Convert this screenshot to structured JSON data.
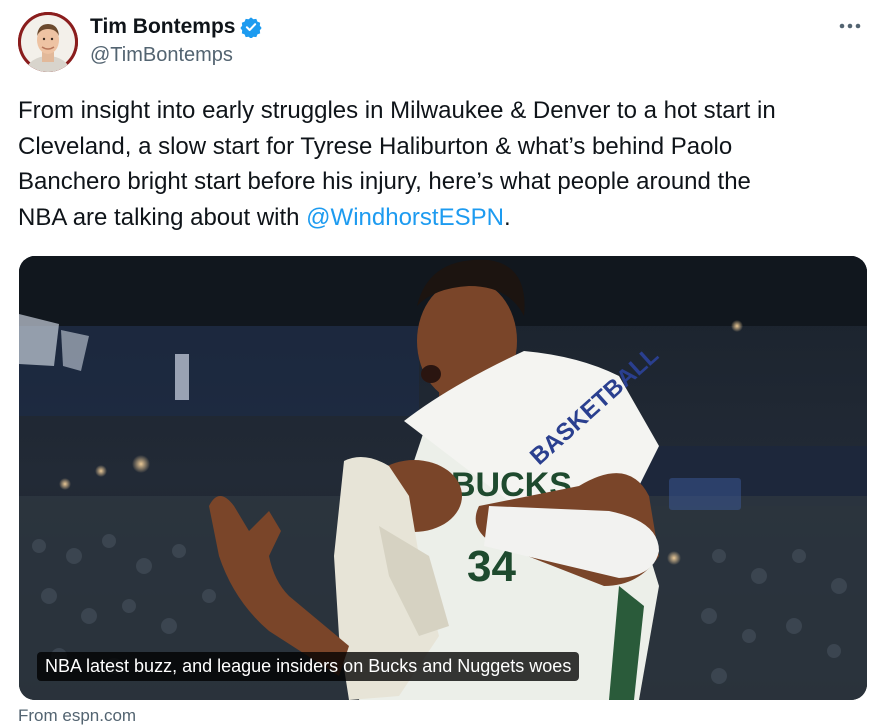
{
  "author": {
    "display_name": "Tim Bontemps",
    "handle": "@TimBontemps",
    "verified": true,
    "avatar_icon": "profile-photo",
    "verified_color": "#1d9bf0"
  },
  "menu_icon": "more-horizontal-icon",
  "tweet": {
    "text_before": "From insight into early struggles in Milwaukee & Denver to a hot start in\nCleveland, a slow start for Tyrese Haliburton & what’s behind Paolo\nBanchero bright start before his injury, here’s what people around the\nNBA are talking about with ",
    "mention": "@WindhorstESPN",
    "text_after": ".",
    "mention_color": "#1d9bf0"
  },
  "link_card": {
    "headline": "NBA latest buzz, and league insiders on Bucks and Nuggets woes",
    "source": "From espn.com",
    "image_description_icon": "article-photo",
    "jersey_number": "34",
    "jersey_text": "BUCKS",
    "towel_text": "BASKETBALL"
  }
}
